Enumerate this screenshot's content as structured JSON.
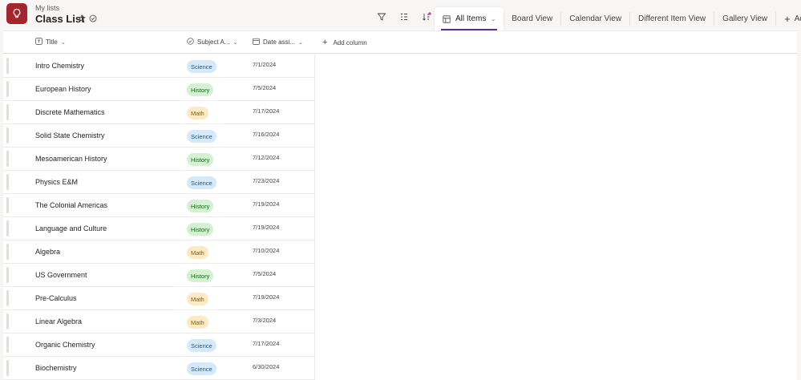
{
  "header": {
    "breadcrumb": "My lists",
    "title": "Class List"
  },
  "icons": {
    "app": "lightbulb-icon",
    "favorite": "star-icon",
    "status": "check-circle-icon",
    "filter": "filter-icon",
    "group": "group-by-icon",
    "sort": "sort-icon"
  },
  "views": {
    "active": "All Items",
    "others": [
      "Board View",
      "Calendar View",
      "Different Item View",
      "Gallery View"
    ],
    "add": "Add view"
  },
  "columns": {
    "title": "Title",
    "subject": "Subject A...",
    "date": "Date assi...",
    "add": "Add column"
  },
  "colors": {
    "accent": "#5c2e91",
    "app_icon": "#a4262c",
    "science_bg": "#d6e9f8",
    "science_fg": "#115ea3",
    "history_bg": "#d5f0d3",
    "history_fg": "#0e700e",
    "math_bg": "#fdeac4",
    "math_fg": "#8a5d00"
  },
  "rows": [
    {
      "title": "Intro Chemistry",
      "subject": "Science",
      "date": "7/1/2024"
    },
    {
      "title": "European History",
      "subject": "History",
      "date": "7/5/2024"
    },
    {
      "title": "Discrete Mathematics",
      "subject": "Math",
      "date": "7/17/2024"
    },
    {
      "title": "Solid State Chemistry",
      "subject": "Science",
      "date": "7/16/2024"
    },
    {
      "title": "Mesoamerican History",
      "subject": "History",
      "date": "7/12/2024"
    },
    {
      "title": "Physics E&M",
      "subject": "Science",
      "date": "7/23/2024"
    },
    {
      "title": "The Colonial Americas",
      "subject": "History",
      "date": "7/19/2024"
    },
    {
      "title": "Language and Culture",
      "subject": "History",
      "date": "7/19/2024"
    },
    {
      "title": "Algebra",
      "subject": "Math",
      "date": "7/10/2024"
    },
    {
      "title": "US Government",
      "subject": "History",
      "date": "7/5/2024"
    },
    {
      "title": "Pre-Calculus",
      "subject": "Math",
      "date": "7/19/2024"
    },
    {
      "title": "Linear Algebra",
      "subject": "Math",
      "date": "7/3/2024"
    },
    {
      "title": "Organic Chemistry",
      "subject": "Science",
      "date": "7/17/2024"
    },
    {
      "title": "Biochemistry",
      "subject": "Science",
      "date": "6/30/2024"
    }
  ]
}
